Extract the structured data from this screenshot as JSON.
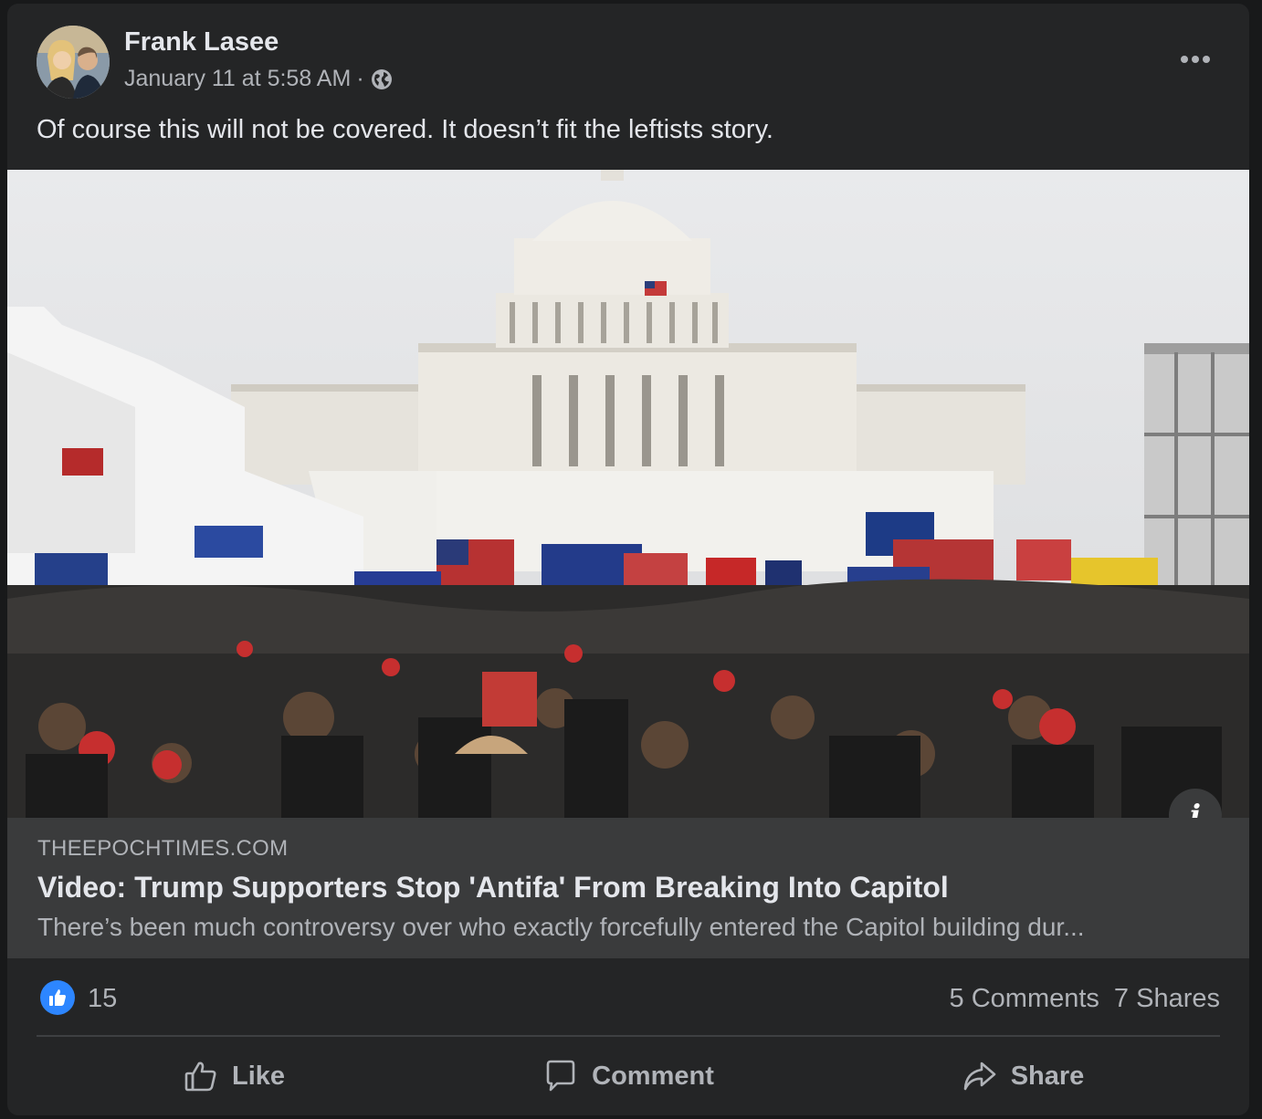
{
  "post": {
    "author": "Frank Lasee",
    "timestamp": "January 11 at 5:58 AM",
    "separator": "·",
    "privacy_icon": "globe-icon",
    "more_icon": "more-options-icon",
    "message": "Of course this will not be covered. It doesn’t fit the leftists story."
  },
  "link": {
    "domain": "THEEPOCHTIMES.COM",
    "headline": "Video: Trump Supporters Stop 'Antifa' From Breaking Into Capitol",
    "description": "There’s been much controversy over who exactly forcefully entered the Capitol building dur...",
    "info_label": "i"
  },
  "stats": {
    "reactions_count": "15",
    "comments": "5 Comments",
    "shares": "7 Shares"
  },
  "actions": {
    "like": "Like",
    "comment": "Comment",
    "share": "Share"
  },
  "colors": {
    "card_bg": "#242526",
    "caption_bg": "#3a3b3c",
    "like_blue": "#2d86ff",
    "text_primary": "#e4e6eb",
    "text_secondary": "#b0b3b8"
  }
}
